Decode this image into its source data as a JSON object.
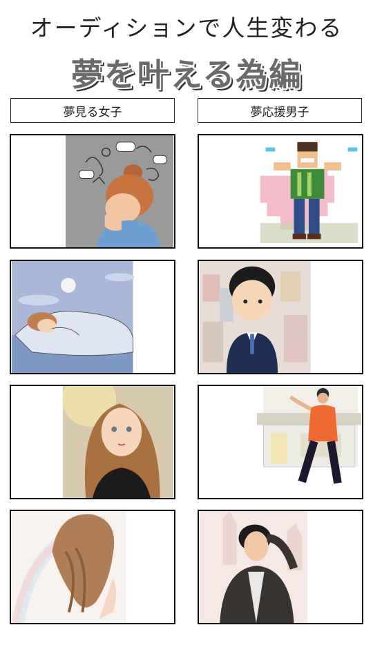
{
  "header": {
    "subtitle": "オーディションで人生変わる",
    "title": "夢を叶える為編"
  },
  "columns": [
    {
      "label": "夢見る女子"
    },
    {
      "label": "夢応援男子"
    }
  ],
  "panels": [
    {
      "column": 0,
      "row": 1,
      "icon": "stressed-girl-illustration"
    },
    {
      "column": 1,
      "row": 1,
      "icon": "pixel-cheering-boy-illustration"
    },
    {
      "column": 0,
      "row": 2,
      "icon": "sleeping-girl-illustration"
    },
    {
      "column": 1,
      "row": 2,
      "icon": "worried-businessman-illustration"
    },
    {
      "column": 0,
      "row": 3,
      "icon": "dreaming-girl-portrait"
    },
    {
      "column": 1,
      "row": 3,
      "icon": "waving-man-illustration"
    },
    {
      "column": 0,
      "row": 4,
      "icon": "girl-back-hair-illustration"
    },
    {
      "column": 1,
      "row": 4,
      "icon": "posing-man-illustration"
    }
  ],
  "colors": {
    "title": "#6a6a6a",
    "border": "#111111",
    "background": "#ffffff"
  }
}
